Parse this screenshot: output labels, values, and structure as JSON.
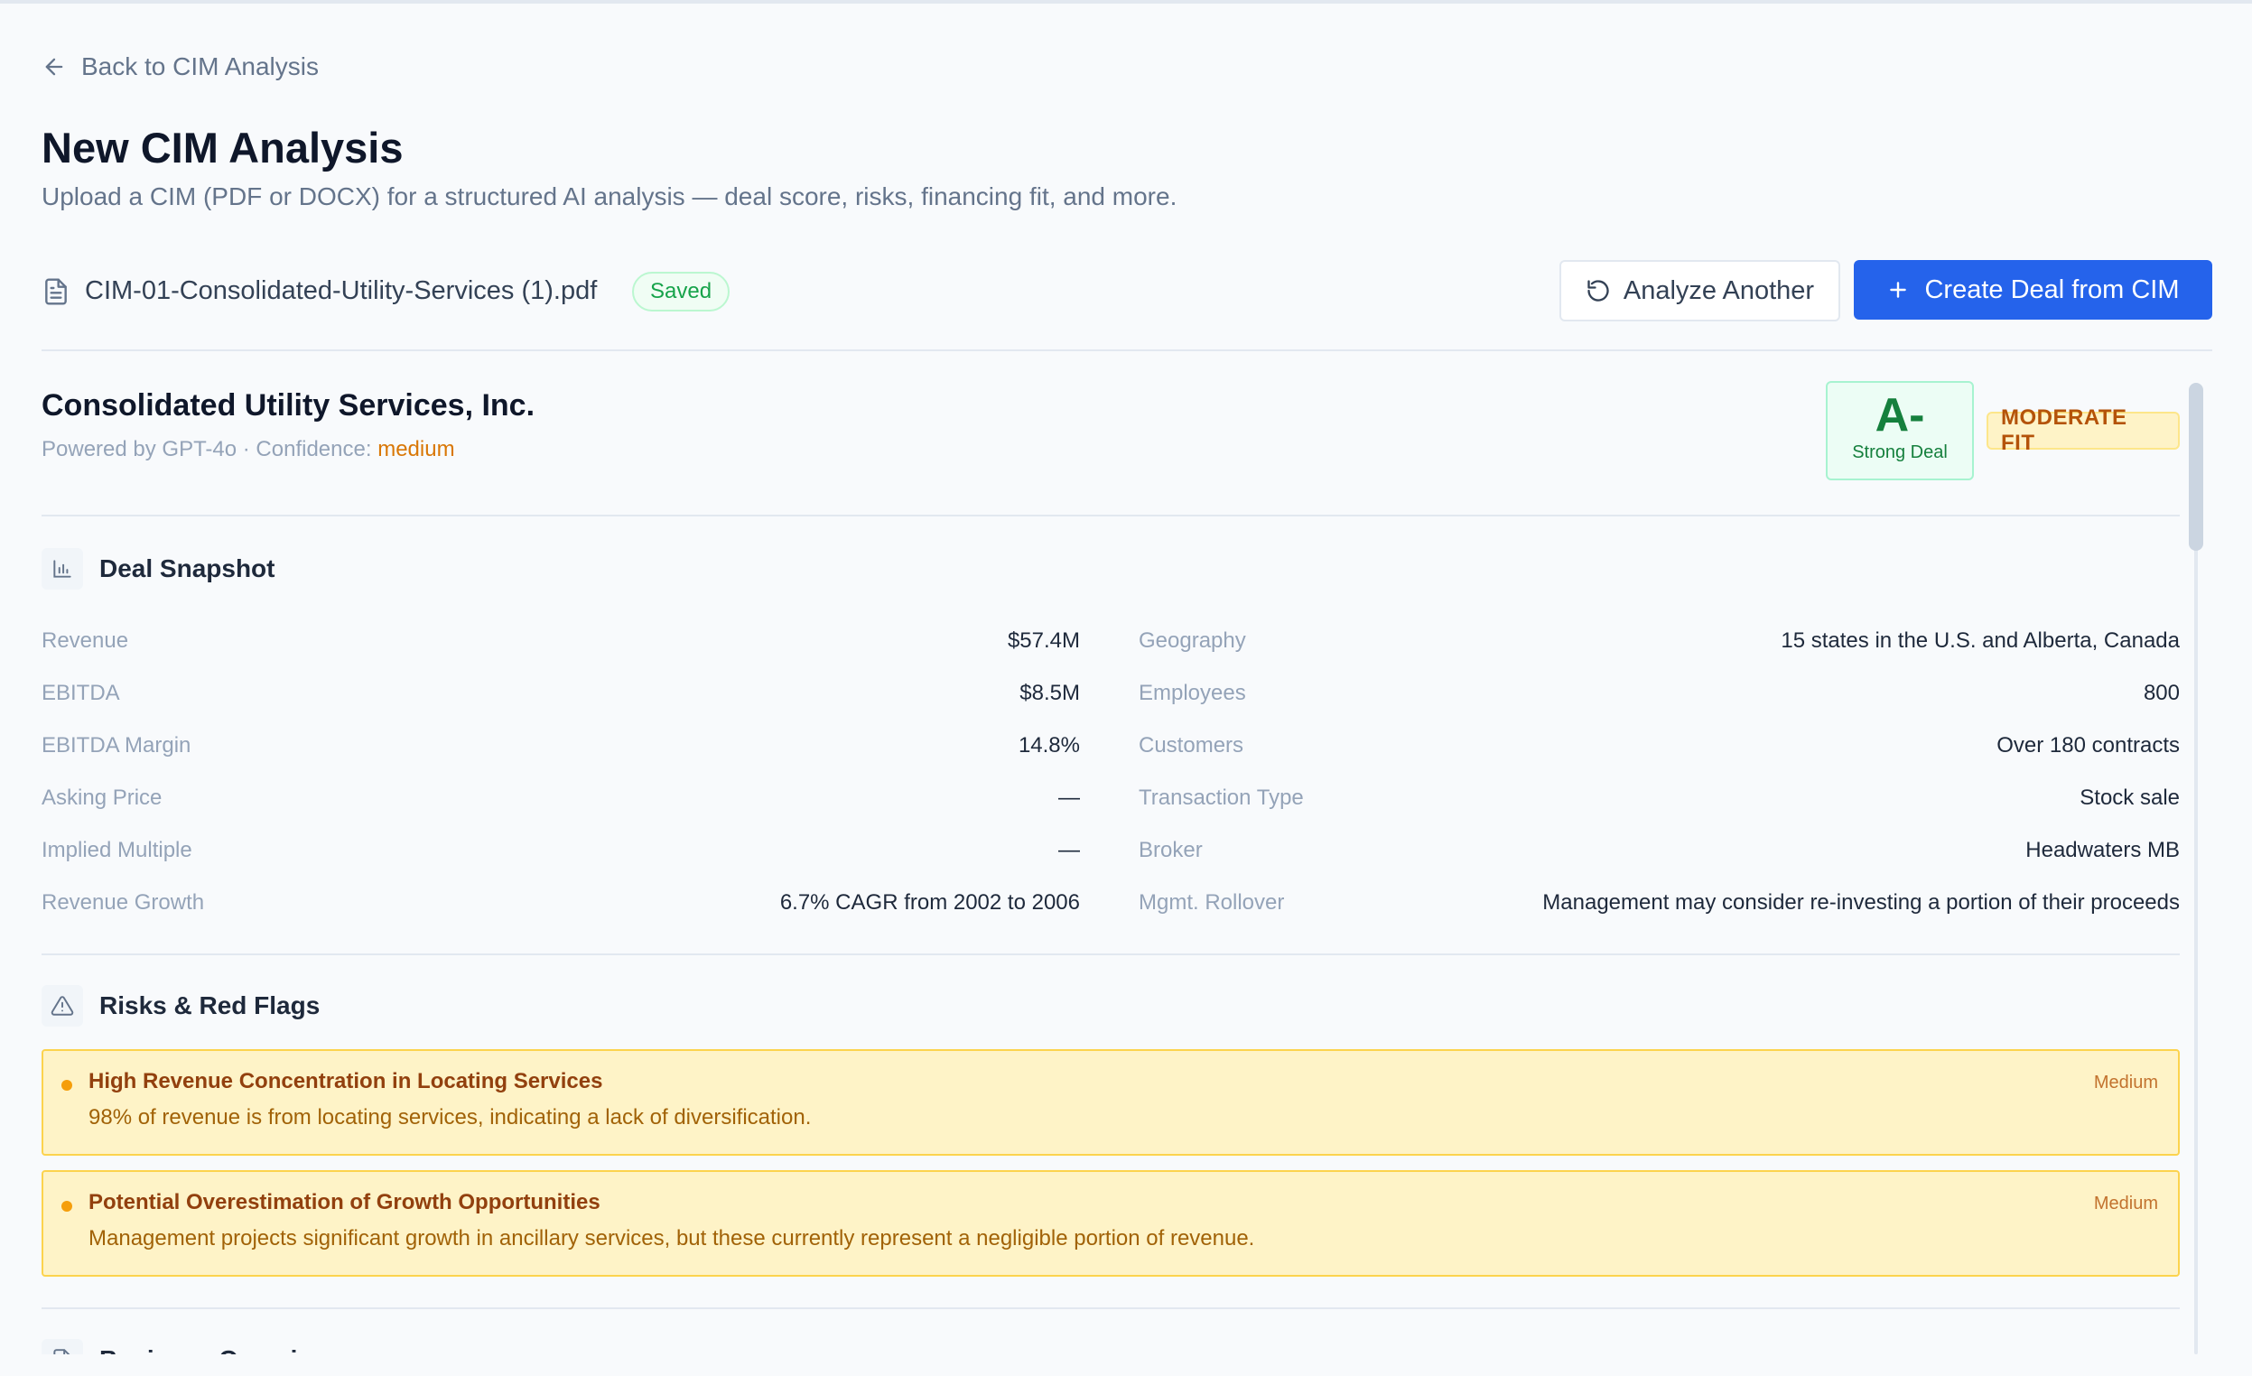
{
  "nav": {
    "back_label": "Back to CIM Analysis"
  },
  "header": {
    "title": "New CIM Analysis",
    "subtitle": "Upload a CIM (PDF or DOCX) for a structured AI analysis — deal score, risks, financing fit, and more."
  },
  "file": {
    "name": "CIM-01-Consolidated-Utility-Services (1).pdf",
    "status": "Saved",
    "icon": "file-text-icon"
  },
  "actions": {
    "analyze_another": "Analyze Another",
    "create_deal": "Create Deal from CIM"
  },
  "report": {
    "company": "Consolidated Utility Services, Inc.",
    "powered_prefix": "Powered by GPT-4o · Confidence:",
    "confidence": "medium",
    "grade": "A-",
    "grade_label": "Strong Deal",
    "fit": "MODERATE FIT"
  },
  "snapshot": {
    "title": "Deal Snapshot",
    "icon": "bar-chart-icon",
    "left": [
      {
        "label": "Revenue",
        "value": "$57.4M"
      },
      {
        "label": "EBITDA",
        "value": "$8.5M"
      },
      {
        "label": "EBITDA Margin",
        "value": "14.8%"
      },
      {
        "label": "Asking Price",
        "value": "—"
      },
      {
        "label": "Implied Multiple",
        "value": "—"
      },
      {
        "label": "Revenue Growth",
        "value": "6.7% CAGR from 2002 to 2006"
      }
    ],
    "right": [
      {
        "label": "Geography",
        "value": "15 states in the U.S. and Alberta, Canada"
      },
      {
        "label": "Employees",
        "value": "800"
      },
      {
        "label": "Customers",
        "value": "Over 180 contracts"
      },
      {
        "label": "Transaction Type",
        "value": "Stock sale"
      },
      {
        "label": "Broker",
        "value": "Headwaters MB"
      },
      {
        "label": "Mgmt. Rollover",
        "value": "Management may consider re-investing a portion of their proceeds"
      }
    ]
  },
  "risks": {
    "title": "Risks & Red Flags",
    "icon": "warning-triangle-icon",
    "items": [
      {
        "title": "High Revenue Concentration in Locating Services",
        "severity": "Medium",
        "description": "98% of revenue is from locating services, indicating a lack of diversification."
      },
      {
        "title": "Potential Overestimation of Growth Opportunities",
        "severity": "Medium",
        "description": "Management projects significant growth in ancillary services, but these currently represent a negligible portion of revenue."
      }
    ]
  },
  "next_section": {
    "title": "Business Overview"
  },
  "colors": {
    "primary": "#2563eb",
    "success": "#16a34a",
    "warning": "#d97706",
    "risk_bg": "#fef3c7"
  }
}
